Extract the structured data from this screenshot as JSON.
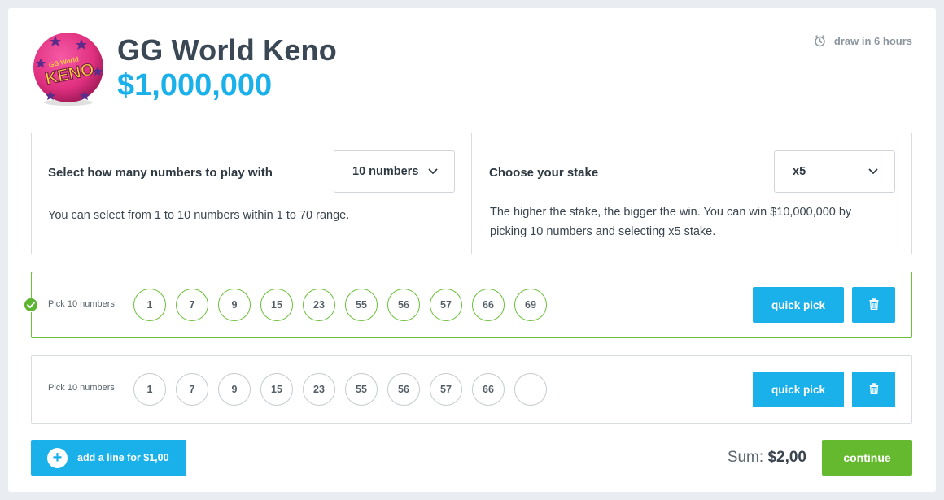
{
  "header": {
    "logo_text_top": "GG World",
    "logo_text_main": "KENO",
    "title": "GG World Keno",
    "jackpot": "$1,000,000",
    "draw_info": "draw in 6 hours",
    "icons": {
      "clock": "clock-icon"
    }
  },
  "options": {
    "numbers": {
      "title": "Select how many numbers to play with",
      "selected": "10 numbers",
      "description": "You can select from 1 to 10 numbers within 1 to 70 range."
    },
    "stake": {
      "title": "Choose your stake",
      "selected": "x5",
      "description": "The higher the stake, the bigger the win. You can win $10,000,000 by picking 10 numbers and selecting x5 stake."
    }
  },
  "lines": [
    {
      "label": "Pick 10 numbers",
      "complete": true,
      "numbers": [
        "1",
        "7",
        "9",
        "15",
        "23",
        "55",
        "56",
        "57",
        "66",
        "69"
      ],
      "quick_pick": "quick pick"
    },
    {
      "label": "Pick 10 numbers",
      "complete": false,
      "numbers": [
        "1",
        "7",
        "9",
        "15",
        "23",
        "55",
        "56",
        "57",
        "66",
        ""
      ],
      "quick_pick": "quick pick"
    }
  ],
  "footer": {
    "add_line": "add a line for $1,00",
    "sum_label": "Sum:",
    "sum_value": "$2,00",
    "continue": "continue"
  },
  "colors": {
    "accent_blue": "#1ab0ea",
    "success_green": "#64b92e",
    "logo_pink": "#e8338a"
  }
}
